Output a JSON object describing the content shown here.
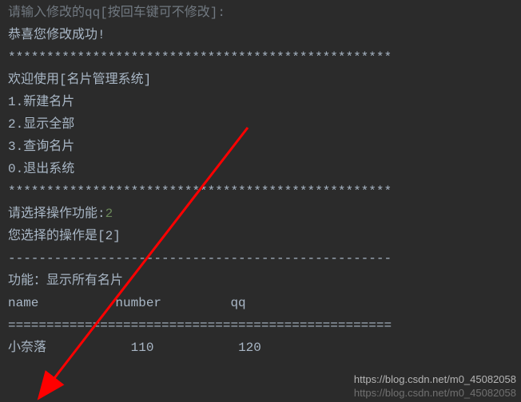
{
  "lines": {
    "top_truncated": "请输入修改的qq[按回车键可不修改]:",
    "success": "恭喜您修改成功!",
    "stars1": "**************************************************",
    "welcome": "欢迎使用[名片管理系统]",
    "menu1": "1.新建名片",
    "menu2": "2.显示全部",
    "menu3": "3.查询名片",
    "menu0": "0.退出系统",
    "stars2": "**************************************************",
    "prompt_prefix": "请选择操作功能:",
    "prompt_input": "2",
    "chosen": "您选择的操作是[2]",
    "dashes1": "--------------------------------------------------",
    "func_label": "功能：显示所有名片",
    "headers": {
      "name": "name",
      "number": "number",
      "qq": "qq"
    },
    "equals1": "==================================================",
    "row1": {
      "name": "小奈落",
      "number": "110",
      "qq": "120"
    }
  },
  "watermark": {
    "line1": "https://blog.csdn.net/m0_45082058",
    "line2": "https://blog.csdn.net/m0_45082058"
  }
}
